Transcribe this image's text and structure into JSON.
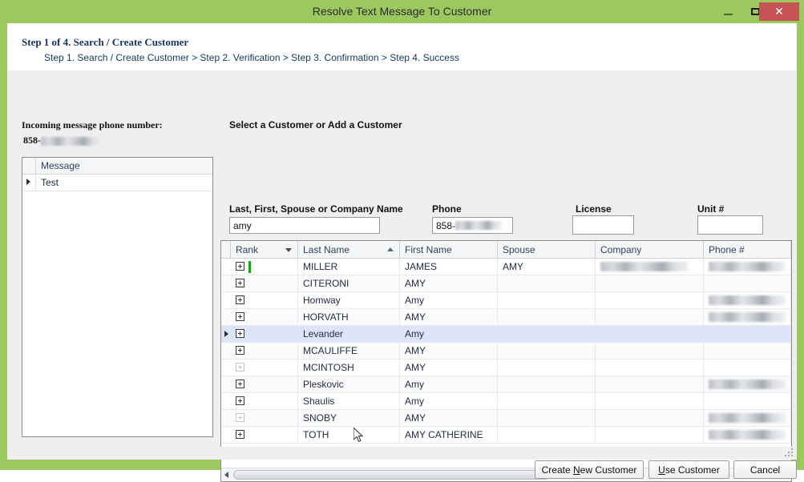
{
  "window": {
    "title": "Resolve Text Message To Customer",
    "minimize_label": "–",
    "maximize_label": "□",
    "close_label": "✕",
    "accent_color": "#9bc95f",
    "close_color": "#c75454"
  },
  "header": {
    "step_title": "Step 1 of 4. Search / Create Customer",
    "breadcrumb": "Step 1. Search / Create Customer  > Step 2. Verification > Step 3. Confirmation > Step 4. Success"
  },
  "left": {
    "incoming_label": "Incoming message phone number:",
    "incoming_prefix": "858-",
    "incoming_redacted": true,
    "message_grid": {
      "header": "Message",
      "rows": [
        {
          "message": "Test",
          "selected": true
        }
      ]
    }
  },
  "right": {
    "section_label": "Select a Customer or Add a Customer",
    "fields": [
      {
        "name": "name",
        "label": "Last, First, Spouse or Company Name",
        "value": "amy",
        "placeholder": ""
      },
      {
        "name": "phone",
        "label": "Phone",
        "value": "858-",
        "redacted": true,
        "placeholder": ""
      },
      {
        "name": "license",
        "label": "License",
        "value": "",
        "placeholder": ""
      },
      {
        "name": "unit",
        "label": "Unit #",
        "value": "",
        "placeholder": ""
      }
    ]
  },
  "grid": {
    "columns": [
      {
        "key": "rank",
        "label": "Rank",
        "sort": "filter"
      },
      {
        "key": "last",
        "label": "Last Name",
        "sort": "asc"
      },
      {
        "key": "first",
        "label": "First Name",
        "sort": "none"
      },
      {
        "key": "spouse",
        "label": "Spouse",
        "sort": "none"
      },
      {
        "key": "company",
        "label": "Company",
        "sort": "none"
      },
      {
        "key": "phone",
        "label": "Phone #",
        "sort": "none"
      }
    ],
    "rows": [
      {
        "last": "MILLER",
        "first": "JAMES",
        "spouse": "AMY",
        "company_redacted": true,
        "phone_redacted": true,
        "rank_flag": true,
        "expander": "normal",
        "selected": false
      },
      {
        "last": "CITERONI",
        "first": "AMY",
        "spouse": "",
        "company_redacted": false,
        "phone_redacted": false,
        "rank_flag": false,
        "expander": "normal",
        "selected": false
      },
      {
        "last": "Homway",
        "first": "Amy",
        "spouse": "",
        "company_redacted": false,
        "phone_redacted": true,
        "rank_flag": false,
        "expander": "normal",
        "selected": false
      },
      {
        "last": "HORVATH",
        "first": "AMY",
        "spouse": "",
        "company_redacted": false,
        "phone_redacted": true,
        "rank_flag": false,
        "expander": "normal",
        "selected": false
      },
      {
        "last": "Levander",
        "first": "Amy",
        "spouse": "",
        "company_redacted": false,
        "phone_redacted": false,
        "rank_flag": false,
        "expander": "normal",
        "selected": true
      },
      {
        "last": "MCAULIFFE",
        "first": "AMY",
        "spouse": "",
        "company_redacted": false,
        "phone_redacted": false,
        "rank_flag": false,
        "expander": "normal",
        "selected": false
      },
      {
        "last": "MCINTOSH",
        "first": "AMY",
        "spouse": "",
        "company_redacted": false,
        "phone_redacted": false,
        "rank_flag": false,
        "expander": "dim",
        "selected": false
      },
      {
        "last": "Pleskovic",
        "first": "Amy",
        "spouse": "",
        "company_redacted": false,
        "phone_redacted": true,
        "rank_flag": false,
        "expander": "normal",
        "selected": false
      },
      {
        "last": "Shaulis",
        "first": "Amy",
        "spouse": "",
        "company_redacted": false,
        "phone_redacted": false,
        "rank_flag": false,
        "expander": "normal",
        "selected": false
      },
      {
        "last": "SNOBY",
        "first": "AMY",
        "spouse": "",
        "company_redacted": false,
        "phone_redacted": true,
        "rank_flag": false,
        "expander": "dim",
        "selected": false
      },
      {
        "last": "TOTH",
        "first": "AMY CATHERINE",
        "spouse": "",
        "company_redacted": false,
        "phone_redacted": true,
        "rank_flag": false,
        "expander": "normal",
        "selected": false
      }
    ],
    "hscroll": {
      "thumb_percent": 58
    }
  },
  "footer": {
    "buttons": [
      {
        "name": "create-new-customer",
        "pre": "Create ",
        "mnemonic": "N",
        "post": "ew Customer"
      },
      {
        "name": "use-customer",
        "pre": "",
        "mnemonic": "U",
        "post": "se Customer"
      },
      {
        "name": "cancel",
        "pre": "Cancel",
        "mnemonic": "",
        "post": ""
      }
    ]
  }
}
